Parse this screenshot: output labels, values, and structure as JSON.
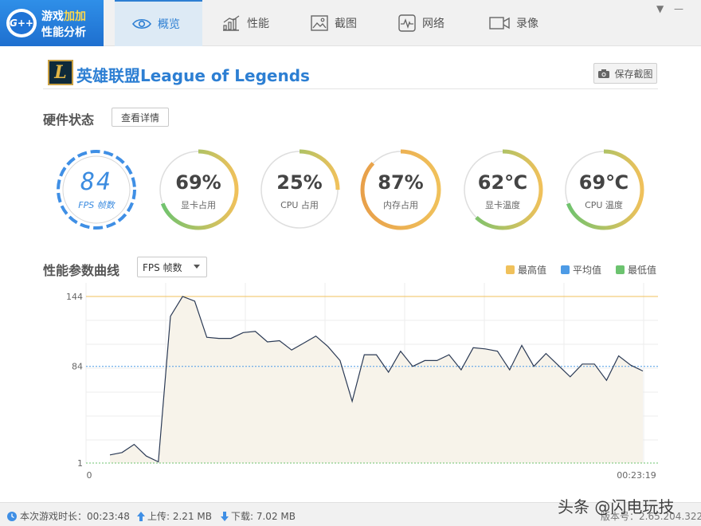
{
  "brand": {
    "logo": "G++",
    "line1_a": "游戏",
    "line1_b": "加加",
    "line2": "性能分析"
  },
  "tabs": [
    {
      "label": "概览",
      "icon": "eye-icon",
      "active": true
    },
    {
      "label": "性能",
      "icon": "bar-chart-icon",
      "active": false
    },
    {
      "label": "截图",
      "icon": "image-icon",
      "active": false
    },
    {
      "label": "网络",
      "icon": "pulse-icon",
      "active": false
    },
    {
      "label": "录像",
      "icon": "video-camera-icon",
      "active": false
    }
  ],
  "window_controls": {
    "menu": "▼",
    "minimize": "—"
  },
  "game": {
    "icon_letter": "L",
    "title": "英雄联盟League of Legends",
    "save_label": "保存截图"
  },
  "hardware": {
    "title": "硬件状态",
    "detail_button": "查看详情",
    "fps": {
      "value": "84",
      "label": "FPS 帧数"
    },
    "gauges": [
      {
        "value": "69%",
        "label": "显卡占用",
        "fraction": 0.69
      },
      {
        "value": "25%",
        "label": "CPU 占用",
        "fraction": 0.25
      },
      {
        "value": "87%",
        "label": "内存占用",
        "fraction": 0.87
      },
      {
        "value": "62℃",
        "label": "显卡温度",
        "fraction": 0.62
      },
      {
        "value": "69℃",
        "label": "CPU 温度",
        "fraction": 0.69
      }
    ]
  },
  "curve": {
    "title": "性能参数曲线",
    "select_value": "FPS 帧数",
    "legend": [
      {
        "label": "最高值",
        "color": "#f0c15b"
      },
      {
        "label": "平均值",
        "color": "#4d9be6"
      },
      {
        "label": "最低值",
        "color": "#6cc36f"
      }
    ]
  },
  "chart_data": {
    "type": "area",
    "ylim": [
      1,
      144
    ],
    "y_ticks": [
      "144",
      "84",
      "1"
    ],
    "x_tick_labels": [
      "0",
      "00:23:19"
    ],
    "max_value": 144,
    "avg_value": 84,
    "min_value": 1,
    "values": [
      8,
      10,
      17,
      7,
      2,
      127,
      144,
      140,
      109,
      108,
      108,
      113,
      114,
      105,
      106,
      98,
      104,
      110,
      101,
      89,
      54,
      94,
      94,
      79,
      97,
      84,
      89,
      89,
      94,
      81,
      100,
      99,
      97,
      81,
      102,
      84,
      95,
      85,
      75,
      86,
      86,
      72,
      93,
      85,
      80
    ]
  },
  "statusbar": {
    "duration": "本次游戏时长：00:23:48",
    "upload": "上传: 2.21 MB",
    "download": "下载: 7.02 MB",
    "version": "版本号：2.65.204.322"
  },
  "watermark": "头条 @闪电玩技"
}
